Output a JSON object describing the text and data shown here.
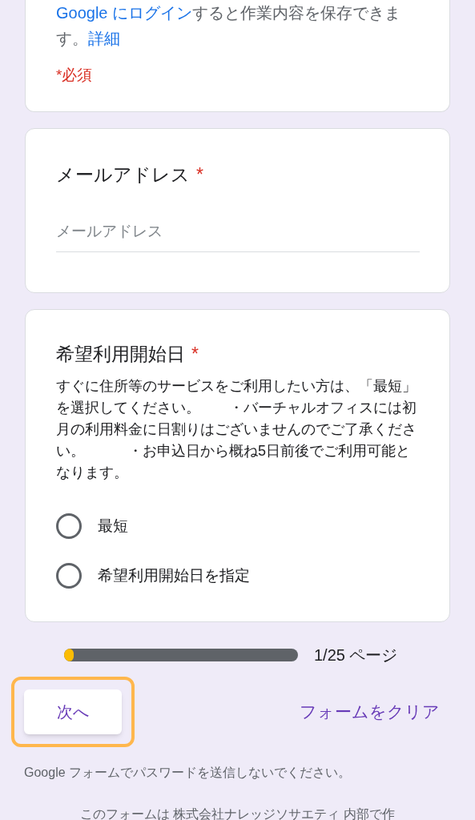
{
  "intro_card": {
    "notice": [
      {
        "kind": "link",
        "text": "Google にログイン"
      },
      {
        "kind": "text",
        "text": "すると作業内容を保存できます。"
      },
      {
        "kind": "link",
        "text": "詳細"
      }
    ],
    "required_note": "*必須"
  },
  "questions": [
    {
      "kind": "text",
      "title": "メールアドレス",
      "required_mark": "*",
      "placeholder": "メールアドレス"
    },
    {
      "kind": "radio",
      "title": "希望利用開始日",
      "required_mark": "*",
      "description": "すぐに住所等のサービスをご利用したい方は、「最短」を選択してください。　　・バーチャルオフィスには初月の利用料金に日割りはございませんのでご了承ください。　　　・お申込日から概ね5日前後でご利用可能となります。",
      "options": [
        {
          "label": "最短",
          "selected": false
        },
        {
          "label": "希望利用開始日を指定",
          "selected": false
        }
      ]
    }
  ],
  "progress": {
    "level": 0.04,
    "label": "1/25 ページ"
  },
  "next_button": {
    "label": "次へ",
    "focused": true
  },
  "clear_link": "フォームをクリア",
  "footer": [
    "Google フォームでパスワードを送信しないでください。",
    "このフォームは 株式会社ナレッジソサエティ 内部で作"
  ]
}
